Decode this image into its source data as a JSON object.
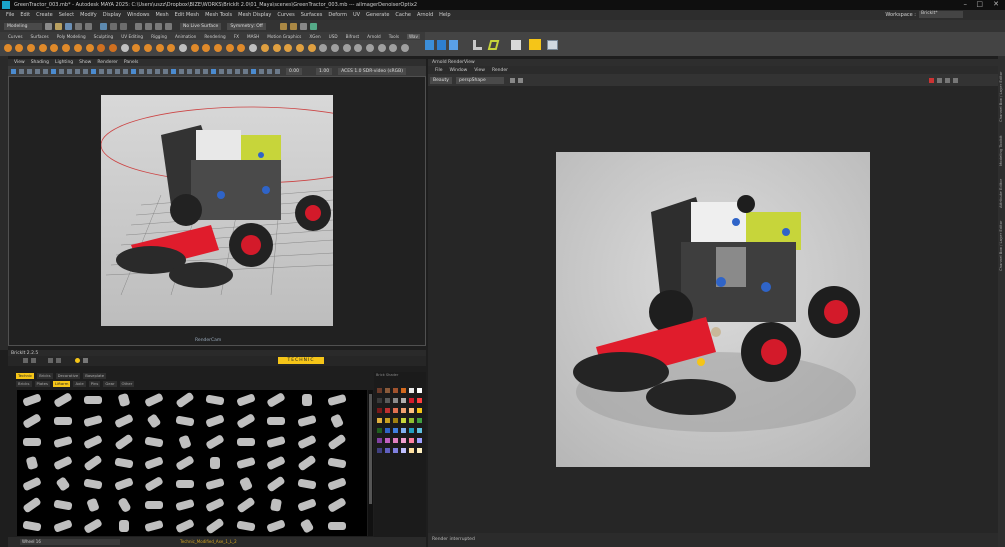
{
  "window": {
    "title": "GreenTractor_003.mb* - Autodesk MAYA 2025: C:\\Users\\uszz\\Dropbox\\BIZE\\WORKS\\BrickIt 2.0\\01_Maya\\scenes\\GreenTractor_003.mb --- aiImagerDenoiserOptix2",
    "controls": [
      "–",
      "□",
      "✕"
    ]
  },
  "menubar": {
    "items": [
      "File",
      "Edit",
      "Create",
      "Select",
      "Modify",
      "Display",
      "Windows",
      "Mesh",
      "Edit Mesh",
      "Mesh Tools",
      "Mesh Display",
      "Curves",
      "Surfaces",
      "Deform",
      "UV",
      "Generate",
      "Cache",
      "Arnold",
      "Help"
    ],
    "workspace_label": "Workspace :",
    "workspace_value": "BrickIt*"
  },
  "statusline": {
    "mode": "Modeling",
    "live_surface": "No Live Surface",
    "symmetry": "Symmetry: Off"
  },
  "shelf": {
    "tabs": [
      "Curves",
      "Surfaces",
      "Poly Modeling",
      "Sculpting",
      "UV Editing",
      "Rigging",
      "Animation",
      "Rendering",
      "FX",
      "MASH",
      "Motion Graphics",
      "XGen",
      "USD",
      "Bifrost",
      "Arnold",
      "Tools",
      "Wav"
    ],
    "active_tab": "Wav"
  },
  "viewport": {
    "menu": [
      "View",
      "Shading",
      "Lighting",
      "Show",
      "Renderer",
      "Panels"
    ],
    "exposure": "0.00",
    "gamma": "1.00",
    "colorspace": "ACES 1.0 SDR-video (sRGB)",
    "camera_label": "RenderCam"
  },
  "brick_browser": {
    "title": "BrickIt 2.2.5",
    "header": "TECHNIC",
    "category_tabs": [
      "Technic",
      "Bricks",
      "Decorative",
      "Baseplate"
    ],
    "sub_tabs": [
      "Bricks",
      "Plates",
      "Liftarm",
      "Axle",
      "Pins",
      "Gear",
      "Other"
    ],
    "selected_category": "Technic",
    "selected_sub": "Liftarm",
    "palette_label": "Brick Shader",
    "footer_field": "Wheel 16",
    "footer_file": "Technic_Modified_Axe_1_L_2"
  },
  "render_view": {
    "title": "Arnold RenderView",
    "menu": [
      "File",
      "Window",
      "View",
      "Render"
    ],
    "aov": "Beauty",
    "camera": "perspShape",
    "status": "Render interrupted"
  },
  "right_tabs": [
    "Channel Box / Layer Editor",
    "Modeling Toolkit",
    "Attribute Editor",
    "Channel Box / Layer Editor"
  ]
}
